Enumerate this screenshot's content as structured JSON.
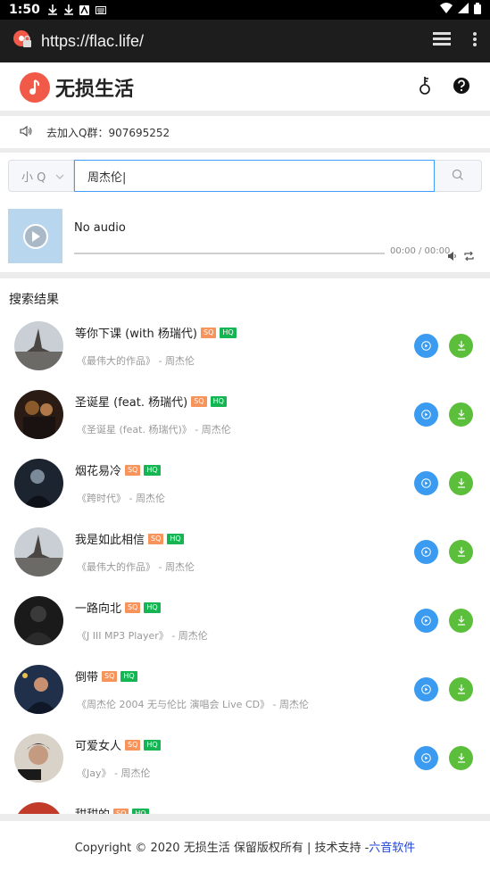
{
  "status_bar": {
    "time": "1:50"
  },
  "browser": {
    "url": "https://flac.life/"
  },
  "header": {
    "site_name": "无损生活"
  },
  "notice": {
    "text": "去加入Q群：907695252"
  },
  "search": {
    "source_label": "小 Q",
    "query": "周杰伦|"
  },
  "player": {
    "title": "No audio",
    "time": "00:00 / 00:00"
  },
  "results": {
    "title": "搜索结果",
    "badges": {
      "sq": "SQ",
      "hq": "HQ"
    },
    "items": [
      {
        "title": "等你下课 (with 杨瑞代)",
        "album": "《最伟大的作品》 - 周杰伦"
      },
      {
        "title": "圣诞星 (feat. 杨瑞代)",
        "album": "《圣诞星 (feat. 杨瑞代)》 - 周杰伦"
      },
      {
        "title": "烟花易冷",
        "album": "《跨时代》 - 周杰伦"
      },
      {
        "title": "我是如此相信",
        "album": "《最伟大的作品》 - 周杰伦"
      },
      {
        "title": "一路向北",
        "album": "《J III MP3 Player》 - 周杰伦"
      },
      {
        "title": "倒带",
        "album": "《周杰伦 2004 无与伦比 演唱会 Live CD》 - 周杰伦"
      },
      {
        "title": "可爱女人",
        "album": "《Jay》 - 周杰伦"
      },
      {
        "title": "甜甜的",
        "album": ""
      }
    ]
  },
  "footer": {
    "text": "Copyright © 2020 无损生活 保留版权所有 | 技术支持 - ",
    "link": "六音软件"
  },
  "colors": {
    "accent_blue": "#409eff",
    "play_button": "#3a9bf1",
    "download_button": "#5cbf3c",
    "sq": "#f7945b",
    "hq": "#14b552",
    "logo": "#f15a48"
  }
}
